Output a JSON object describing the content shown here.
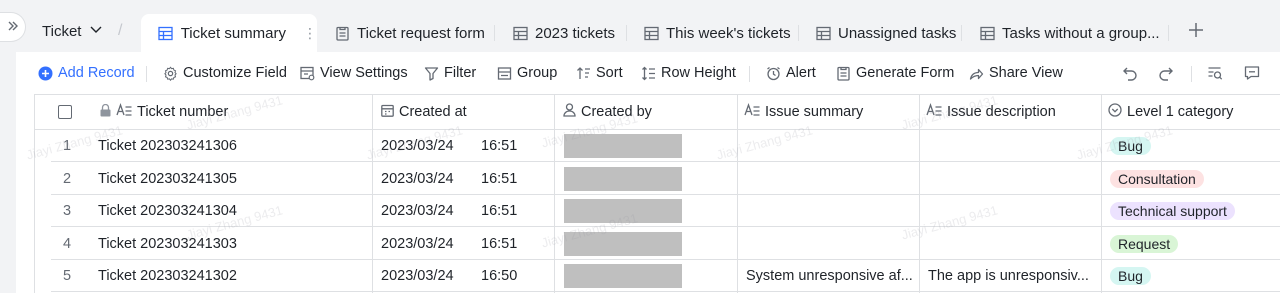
{
  "base": {
    "name": "Ticket"
  },
  "tabs": [
    {
      "label": "Ticket summary",
      "active": true
    },
    {
      "label": "Ticket request form",
      "active": false
    },
    {
      "label": "2023 tickets",
      "active": false
    },
    {
      "label": "This week's tickets",
      "active": false
    },
    {
      "label": "Unassigned tasks",
      "active": false
    },
    {
      "label": "Tasks without a group...",
      "active": false
    }
  ],
  "toolbar": {
    "add_record": "Add Record",
    "customize_field": "Customize Field",
    "view_settings": "View Settings",
    "filter": "Filter",
    "group": "Group",
    "sort": "Sort",
    "row_height": "Row Height",
    "alert": "Alert",
    "generate_form": "Generate Form",
    "share_view": "Share View"
  },
  "columns": {
    "ticket_number": "Ticket number",
    "created_at": "Created at",
    "created_by": "Created by",
    "issue_summary": "Issue summary",
    "issue_description": "Issue description",
    "level1_category": "Level 1 category"
  },
  "rows": [
    {
      "num": "1",
      "ticket": "Ticket 202303241306",
      "date": "2023/03/24",
      "time": "16:51",
      "summary": "",
      "description": "",
      "category": "Bug"
    },
    {
      "num": "2",
      "ticket": "Ticket 202303241305",
      "date": "2023/03/24",
      "time": "16:51",
      "summary": "",
      "description": "",
      "category": "Consultation"
    },
    {
      "num": "3",
      "ticket": "Ticket 202303241304",
      "date": "2023/03/24",
      "time": "16:51",
      "summary": "",
      "description": "",
      "category": "Technical support"
    },
    {
      "num": "4",
      "ticket": "Ticket 202303241303",
      "date": "2023/03/24",
      "time": "16:51",
      "summary": "",
      "description": "",
      "category": "Request"
    },
    {
      "num": "5",
      "ticket": "Ticket 202303241302",
      "date": "2023/03/24",
      "time": "16:50",
      "summary": "System unresponsive af...",
      "description": "The app is unresponsiv...",
      "category": "Bug"
    }
  ],
  "category_colors": {
    "Bug": {
      "bg": "#d5f6f2",
      "fg": "#1f2329"
    },
    "Consultation": {
      "bg": "#fde2e2",
      "fg": "#1f2329"
    },
    "Technical support": {
      "bg": "#ece2fe",
      "fg": "#1f2329"
    },
    "Request": {
      "bg": "#d9f5d6",
      "fg": "#1f2329"
    }
  },
  "watermark": "Jiayi Zhang 9431",
  "accent_color": "#3370ff"
}
